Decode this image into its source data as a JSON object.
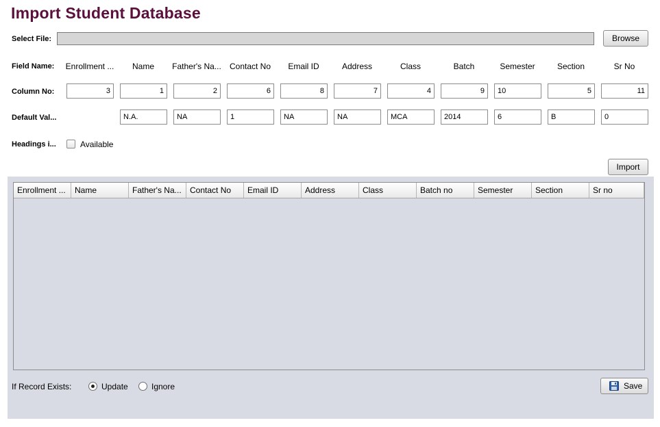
{
  "title": "Import Student Database",
  "select_file": {
    "label": "Select File:",
    "value": "",
    "browse_label": "Browse"
  },
  "field_name_label": "Field Name:",
  "column_no_label": "Column No:",
  "default_values_label": "Default Val...",
  "headings_label": "Headings i...",
  "available_label": "Available",
  "available_checked": false,
  "fields": [
    {
      "name": "Enrollment ...",
      "column": "3",
      "default": null
    },
    {
      "name": "Name",
      "column": "1",
      "default": "N.A."
    },
    {
      "name": "Father's Na...",
      "column": "2",
      "default": "NA"
    },
    {
      "name": "Contact No",
      "column": "6",
      "default": "1"
    },
    {
      "name": "Email ID",
      "column": "8",
      "default": "NA"
    },
    {
      "name": "Address",
      "column": "7",
      "default": "NA"
    },
    {
      "name": "Class",
      "column": "4",
      "default": "MCA"
    },
    {
      "name": "Batch",
      "column": "9",
      "default": "2014"
    },
    {
      "name": "Semester",
      "column": "10",
      "default": "6"
    },
    {
      "name": "Section",
      "column": "5",
      "default": "B"
    },
    {
      "name": "Sr No",
      "column": "11",
      "default": "0"
    }
  ],
  "import_label": "Import",
  "table": {
    "columns": [
      "Enrollment ...",
      "Name",
      "Father's Na...",
      "Contact No",
      "Email ID",
      "Address",
      "Class",
      "Batch no",
      "Semester",
      "Section",
      "Sr no"
    ],
    "rows": []
  },
  "record_exists": {
    "label": "If Record Exists:",
    "options": [
      "Update",
      "Ignore"
    ],
    "selected": "Update"
  },
  "save_label": "Save",
  "colors": {
    "title": "#5a0f3c",
    "panel": "#d8dbe3"
  },
  "icons": {
    "save": "floppy-disk-icon"
  }
}
